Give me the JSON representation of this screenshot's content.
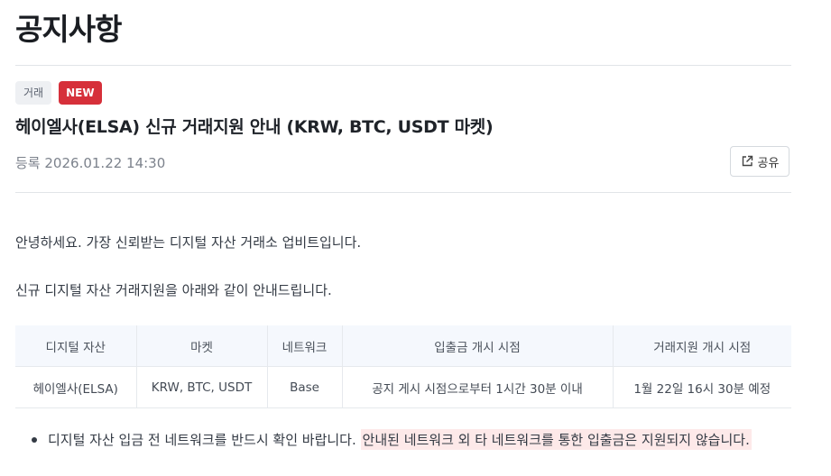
{
  "page": {
    "title": "공지사항"
  },
  "notice": {
    "category_badge": "거래",
    "new_badge": "NEW",
    "title": "헤이엘사(ELSA) 신규 거래지원 안내 (KRW, BTC, USDT 마켓)",
    "date_label": "등록",
    "date_value": "2026.01.22 14:30",
    "share_label": "공유"
  },
  "body": {
    "greeting": "안녕하세요. 가장 신뢰받는 디지털 자산 거래소 업비트입니다.",
    "intro": "신규 디지털 자산 거래지원을 아래와 같이 안내드립니다."
  },
  "table": {
    "headers": [
      "디지털 자산",
      "마켓",
      "네트워크",
      "입출금 개시 시점",
      "거래지원 개시 시점"
    ],
    "rows": [
      [
        "헤이엘사(ELSA)",
        "KRW, BTC, USDT",
        "Base",
        "공지 게시 시점으로부터 1시간 30분 이내",
        "1월 22일 16시 30분 예정"
      ]
    ]
  },
  "bullets": [
    {
      "text": "디지털 자산 입금 전 네트워크를 반드시 확인 바랍니다.",
      "highlight": "안내된 네트워크 외 타 네트워크를 통한 입출금은 지원되지 않습니다."
    }
  ],
  "colors": {
    "new_badge": "#d6303a",
    "highlight": "#fde9e9",
    "table_header_bg": "#f5f8fd"
  }
}
